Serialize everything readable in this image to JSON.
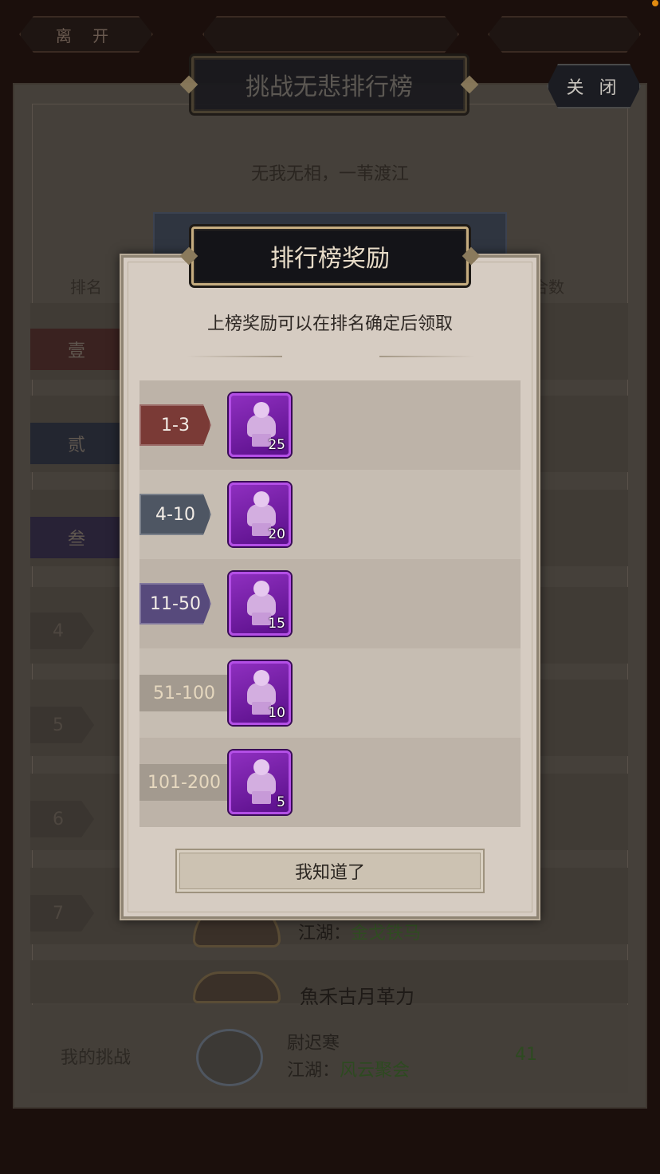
{
  "hud": {
    "leave_label": "离 开",
    "event_title": "",
    "time_text": ""
  },
  "board": {
    "title": "挑战无悲排行榜",
    "close_label": "关 闭",
    "subtitle": "无我无相，一苇渡江",
    "col_rank": "排名",
    "col_score": "合数",
    "rank_labels": [
      "壹",
      "贰",
      "叁",
      "4",
      "5",
      "6",
      "7"
    ],
    "visible_rows": [
      {
        "guild_prefix": "江湖：",
        "guild": "金戈铁马"
      },
      {
        "name": "魚禾古月革力"
      }
    ],
    "my_challenge": {
      "label": "我的挑战",
      "name": "尉迟寒",
      "guild_prefix": "江湖：",
      "guild": "风云聚会",
      "score": "41"
    }
  },
  "modal": {
    "title": "排行榜奖励",
    "subtitle": "上榜奖励可以在排名确定后领取",
    "rewards": [
      {
        "rank": "1-3",
        "count": "25",
        "tag_color": "#7a3a36",
        "style": "tag"
      },
      {
        "rank": "4-10",
        "count": "20",
        "tag_color": "#4e5663",
        "style": "tag"
      },
      {
        "rank": "11-50",
        "count": "15",
        "tag_color": "#574a7c",
        "style": "tag"
      },
      {
        "rank": "51-100",
        "count": "10",
        "tag_color": "#a39a8f",
        "style": "plain"
      },
      {
        "rank": "101-200",
        "count": "5",
        "tag_color": "#a39a8f",
        "style": "plain"
      }
    ],
    "ok_label": "我知道了"
  }
}
